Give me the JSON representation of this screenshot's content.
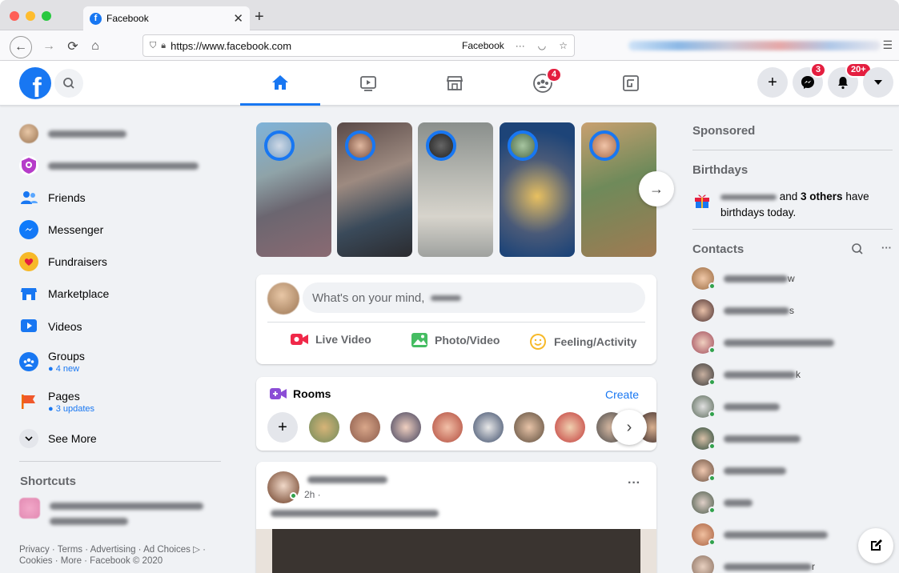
{
  "browser": {
    "tab_title": "Facebook",
    "url": "https://www.facebook.com",
    "url_host": "facebook.com",
    "site_label": "Facebook",
    "more": "···"
  },
  "header": {
    "messenger_badge": "3",
    "notif_badge": "20+",
    "groups_badge": "4"
  },
  "sidebar": {
    "items": [
      {
        "label": "Friends"
      },
      {
        "label": "Messenger"
      },
      {
        "label": "Fundraisers"
      },
      {
        "label": "Marketplace"
      },
      {
        "label": "Videos"
      },
      {
        "label": "Groups",
        "sub": "● 4 new"
      },
      {
        "label": "Pages",
        "sub": "● 3 updates"
      },
      {
        "label": "See More"
      }
    ],
    "shortcuts_title": "Shortcuts",
    "footer": "Privacy · Terms · Advertising · Ad Choices ▷ · Cookies · More · Facebook © 2020"
  },
  "composer": {
    "placeholder": "What's on your mind,",
    "live": "Live Video",
    "photo": "Photo/Video",
    "feeling": "Feeling/Activity"
  },
  "rooms": {
    "title": "Rooms",
    "create": "Create"
  },
  "post": {
    "time": "2h ·"
  },
  "right": {
    "sponsored": "Sponsored",
    "birthdays": "Birthdays",
    "birthday_and": "and ",
    "birthday_others": "3 others",
    "birthday_tail": " have",
    "birthday_line2": "birthdays today.",
    "contacts": "Contacts",
    "contact_suffixes": [
      "w",
      "s",
      "",
      "k",
      "",
      "",
      "",
      "",
      "",
      "r"
    ]
  },
  "colors": {
    "brand": "#1877f2",
    "badge": "#e41e3f",
    "online": "#31a24c"
  }
}
